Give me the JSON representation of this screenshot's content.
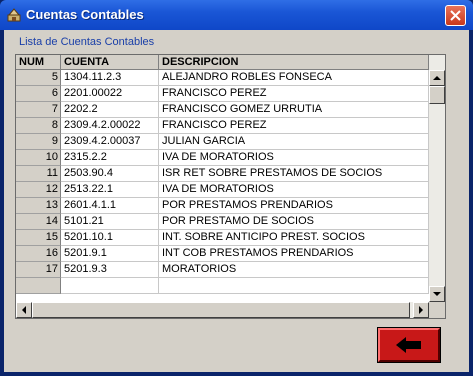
{
  "window": {
    "title": "Cuentas Contables"
  },
  "list": {
    "label": "Lista de Cuentas Contables",
    "columns": [
      "NUM",
      "CUENTA",
      "DESCRIPCION"
    ],
    "rows": [
      [
        "5",
        "1304.11.2.3",
        "ALEJANDRO ROBLES FONSECA"
      ],
      [
        "6",
        "2201.00022",
        "FRANCISCO PEREZ"
      ],
      [
        "7",
        "2202.2",
        "FRANCISCO GOMEZ URRUTIA"
      ],
      [
        "8",
        "2309.4.2.00022",
        "FRANCISCO PEREZ"
      ],
      [
        "9",
        "2309.4.2.00037",
        "JULIAN GARCIA"
      ],
      [
        "10",
        "2315.2.2",
        "IVA DE MORATORIOS"
      ],
      [
        "11",
        "2503.90.4",
        "ISR RET SOBRE PRESTAMOS DE SOCIOS"
      ],
      [
        "12",
        "2513.22.1",
        "IVA DE MORATORIOS"
      ],
      [
        "13",
        "2601.4.1.1",
        "POR PRESTAMOS PRENDARIOS"
      ],
      [
        "14",
        "5101.21",
        "POR PRESTAMO DE SOCIOS"
      ],
      [
        "15",
        "5201.10.1",
        "INT. SOBRE ANTICIPO PREST. SOCIOS"
      ],
      [
        "16",
        "5201.9.1",
        "INT COB PRESTAMOS PRENDARIOS"
      ],
      [
        "17",
        "5201.9.3",
        "MORATORIOS"
      ],
      [
        "",
        "",
        ""
      ]
    ]
  },
  "icons": {
    "app": "app-icon",
    "close": "close-icon",
    "back": "back-arrow-icon",
    "scroll_up": "arrow-up-icon",
    "scroll_down": "arrow-down-icon",
    "scroll_left": "arrow-left-icon",
    "scroll_right": "arrow-right-icon"
  },
  "colors": {
    "title_bar": "#1a56d6",
    "back_button": "#c81818",
    "label_text": "#1a3fa8"
  }
}
